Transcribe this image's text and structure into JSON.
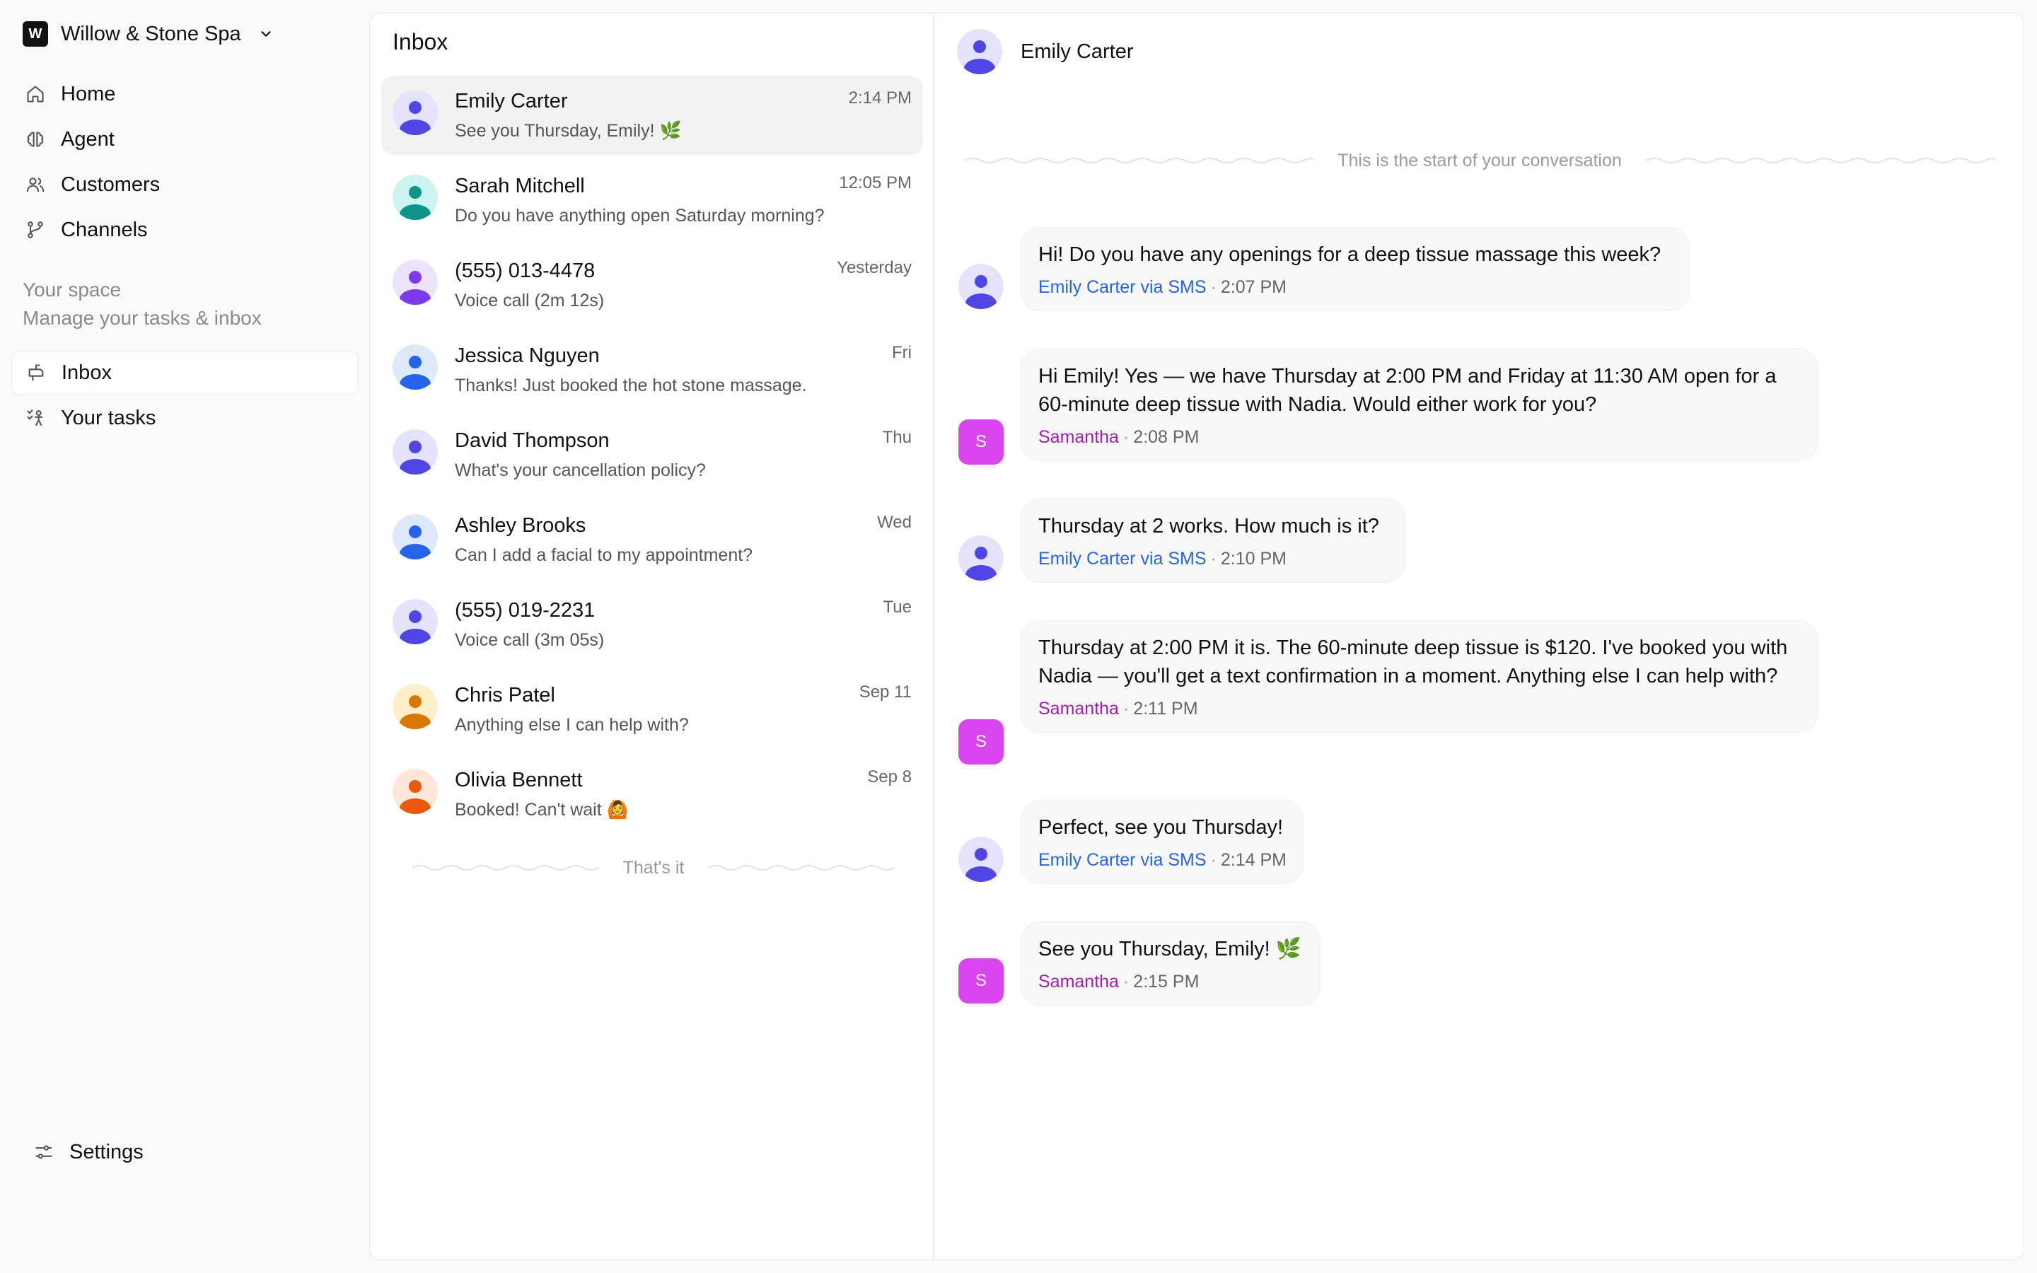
{
  "workspace": {
    "logo_letter": "W",
    "name": "Willow & Stone Spa"
  },
  "nav": [
    {
      "label": "Home",
      "icon": "home-icon"
    },
    {
      "label": "Agent",
      "icon": "brain-icon"
    },
    {
      "label": "Customers",
      "icon": "users-icon"
    },
    {
      "label": "Channels",
      "icon": "channels-icon"
    }
  ],
  "space": {
    "title": "Your space",
    "subtitle": "Manage your tasks & inbox",
    "items": [
      {
        "label": "Inbox",
        "icon": "inbox-icon",
        "active": true
      },
      {
        "label": "Your tasks",
        "icon": "tasks-icon",
        "active": false
      }
    ]
  },
  "settings": {
    "label": "Settings",
    "icon": "sliders-icon"
  },
  "inbox": {
    "title": "Inbox",
    "end_label": "That's it",
    "conversations": [
      {
        "name": "Emily Carter",
        "preview": "See you Thursday, Emily! 🌿",
        "time": "2:14 PM",
        "avatar_bg": "#e5e3fb",
        "avatar_fg": "#4f46e5",
        "selected": true
      },
      {
        "name": "Sarah Mitchell",
        "preview": "Do you have anything open Saturday morning?",
        "time": "12:05 PM",
        "avatar_bg": "#ccf4ef",
        "avatar_fg": "#0d9488",
        "selected": false
      },
      {
        "name": "(555) 013-4478",
        "preview": "Voice call (2m 12s)",
        "time": "Yesterday",
        "avatar_bg": "#ede3fb",
        "avatar_fg": "#7c3aed",
        "selected": false
      },
      {
        "name": "Jessica Nguyen",
        "preview": "Thanks! Just booked the hot stone massage.",
        "time": "Fri",
        "avatar_bg": "#dde8fb",
        "avatar_fg": "#2563eb",
        "selected": false
      },
      {
        "name": "David Thompson",
        "preview": "What's your cancellation policy?",
        "time": "Thu",
        "avatar_bg": "#e5e3fb",
        "avatar_fg": "#4f46e5",
        "selected": false
      },
      {
        "name": "Ashley Brooks",
        "preview": "Can I add a facial to my appointment?",
        "time": "Wed",
        "avatar_bg": "#dde8fb",
        "avatar_fg": "#2563eb",
        "selected": false
      },
      {
        "name": "(555) 019-2231",
        "preview": "Voice call (3m 05s)",
        "time": "Tue",
        "avatar_bg": "#e5e3fb",
        "avatar_fg": "#4f46e5",
        "selected": false
      },
      {
        "name": "Chris Patel",
        "preview": "Anything else I can help with?",
        "time": "Sep 11",
        "avatar_bg": "#fdf0c8",
        "avatar_fg": "#d97706",
        "selected": false
      },
      {
        "name": "Olivia Bennett",
        "preview": "Booked! Can't wait 🙆",
        "time": "Sep 8",
        "avatar_bg": "#fde6d8",
        "avatar_fg": "#ea580c",
        "selected": false
      }
    ]
  },
  "chat": {
    "contact_name": "Emily Carter",
    "start_label": "This is the start of your conversation",
    "messages": [
      {
        "from": "contact",
        "text": "Hi! Do you have any openings for a deep tissue massage this week?",
        "author": "Emily Carter via SMS",
        "time": "2:07 PM"
      },
      {
        "from": "agent",
        "agent_initial": "S",
        "text": "Hi Emily! Yes — we have Thursday at 2:00 PM and Friday at 11:30 AM open for a 60-minute deep tissue with Nadia. Would either work for you?",
        "author": "Samantha",
        "time": "2:08 PM"
      },
      {
        "from": "contact",
        "text": "Thursday at 2 works. How much is it?",
        "author": "Emily Carter via SMS",
        "time": "2:10 PM"
      },
      {
        "from": "agent",
        "agent_initial": "S",
        "text": "Thursday at 2:00 PM it is. The 60-minute deep tissue is $120. I've booked you with Nadia — you'll get a text confirmation in a moment. Anything else I can help with?",
        "author": "Samantha",
        "time": "2:11 PM"
      },
      {
        "from": "contact",
        "text": "Perfect, see you Thursday!",
        "author": "Emily Carter via SMS",
        "time": "2:14 PM"
      },
      {
        "from": "agent",
        "agent_initial": "S",
        "text": "See you Thursday, Emily! 🌿",
        "author": "Samantha",
        "time": "2:15 PM"
      }
    ]
  },
  "colors": {
    "contact_author": "#2563eb",
    "agent_author": "#a21caf",
    "agent_avatar": "#d946ef",
    "selected_row": "#f2f2f2"
  }
}
